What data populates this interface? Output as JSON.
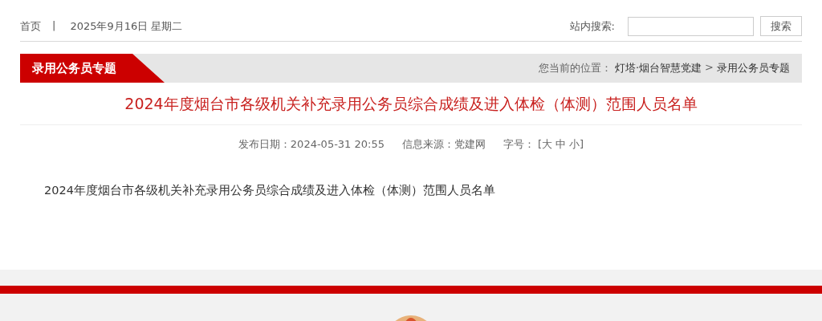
{
  "top_bar": {
    "home_link": "首页",
    "separator": "|",
    "date": "2025年9月16日 星期二",
    "search_label": "站内搜索:",
    "search_button": "搜索"
  },
  "section_header": {
    "title": "录用公务员专题",
    "location_label": "您当前的位置：",
    "breadcrumbs": [
      "灯塔·烟台智慧党建",
      "录用公务员专题"
    ],
    "breadcrumb_separator": ">"
  },
  "article": {
    "title": "2024年度烟台市各级机关补充录用公务员综合成绩及进入体检（体测）范围人员名单",
    "publish_date": "发布日期：2024-05-31 20:55",
    "source": "信息来源：党建网",
    "font_size_label": "字号：",
    "font_sizes": [
      "[大",
      "中",
      "小]"
    ],
    "body": "2024年度烟台市各级机关补充录用公务员综合成绩及进入体检（体测）范围人员名单"
  }
}
